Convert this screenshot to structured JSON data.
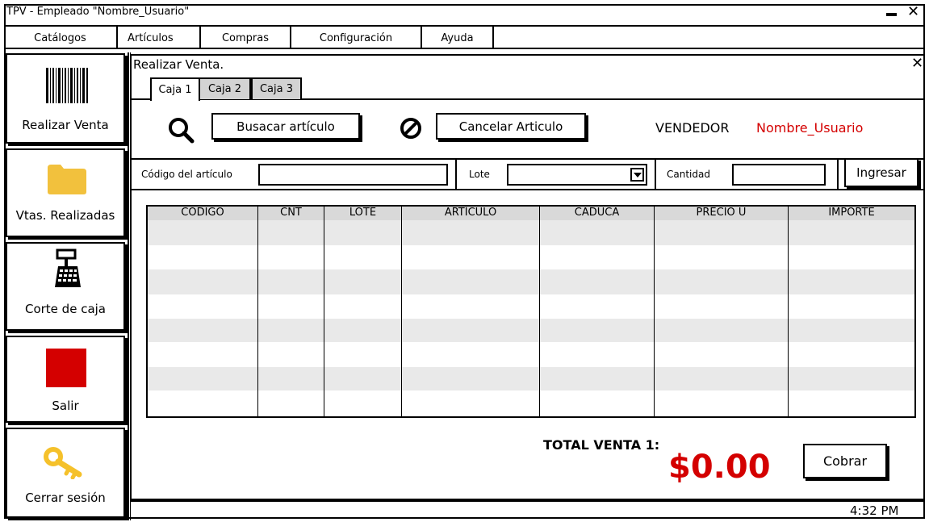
{
  "window": {
    "title": "TPV - Empleado \"Nombre_Usuario\"",
    "minimize_glyph": "",
    "close_glyph": "✕"
  },
  "menu": [
    "Catálogos",
    "Artículos",
    "Compras",
    "Configuración",
    "Ayuda"
  ],
  "sidebar": [
    {
      "label": "Realizar Venta",
      "icon": "barcode-icon"
    },
    {
      "label": "Vtas. Realizadas",
      "icon": "folder-icon"
    },
    {
      "label": "Corte de caja",
      "icon": "cash-register-icon"
    },
    {
      "label": "Salir",
      "icon": "stop-square-icon"
    },
    {
      "label": "Cerrar sesión",
      "icon": "key-icon"
    }
  ],
  "panel": {
    "title": "Realizar Venta.",
    "close_glyph": "✕"
  },
  "tabs": [
    "Caja 1",
    "Caja 2",
    "Caja 3"
  ],
  "actions": {
    "search_label": "Busacar artículo",
    "cancel_label": "Cancelar Articulo"
  },
  "vendor": {
    "label": "VENDEDOR",
    "name": "Nombre_Usuario"
  },
  "form": {
    "code_label": "Código del artículo",
    "code_value": "",
    "lot_label": "Lote",
    "lot_value": "",
    "qty_label": "Cantidad",
    "qty_value": "",
    "submit_label": "Ingresar"
  },
  "table": {
    "columns": [
      "CÓDIGO",
      "CNT",
      "LOTE",
      "ARTÍCULO",
      "CADUCA",
      "PRECIO U",
      "IMPORTE"
    ],
    "rows": []
  },
  "totals": {
    "label": "TOTAL VENTA 1:",
    "value": "$0.00"
  },
  "checkout_label": "Cobrar",
  "status": {
    "time": "4:32 PM"
  },
  "colors": {
    "accent_red": "#d40000",
    "folder_yellow": "#f2c13d",
    "stop_red": "#d40000",
    "key_yellow": "#f5c12b",
    "stripe": "#e9e9e9"
  }
}
